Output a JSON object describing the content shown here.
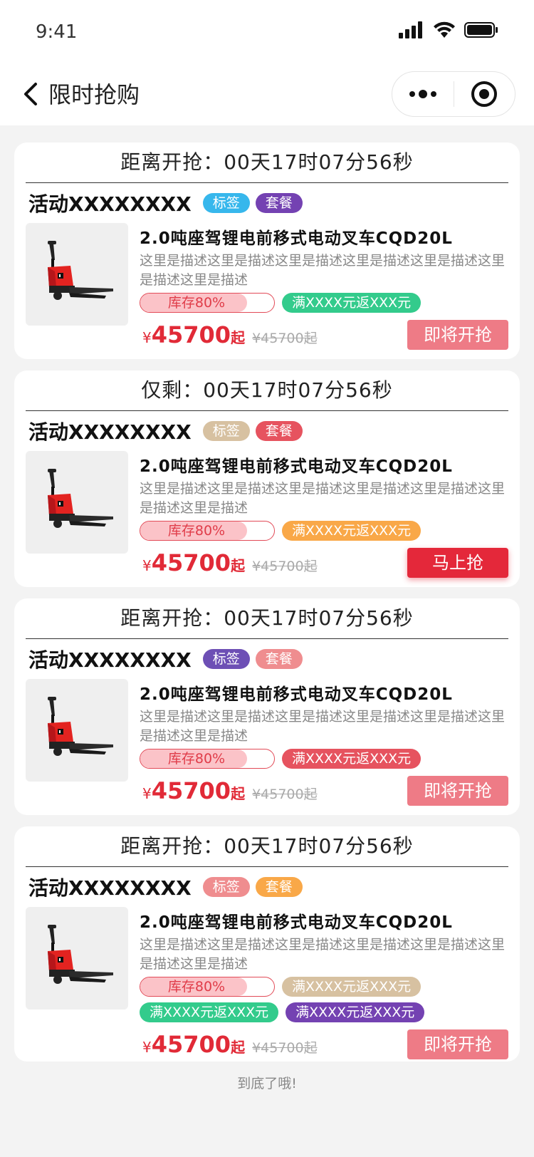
{
  "status": {
    "time": "9:41"
  },
  "nav": {
    "title": "限时抢购"
  },
  "colors": {
    "cyan": "#37b7ec",
    "purple": "#7442b2",
    "tan": "#d7c1a1",
    "red": "#e6535f",
    "orange": "#f9a848",
    "green": "#33cb8c",
    "violet": "#6d4fb5",
    "pink": "#ef8d8f"
  },
  "cards": [
    {
      "countdown": "距离开抢：00天17时07分56秒",
      "activity": "活动XXXXXXXX",
      "tags": [
        "标签",
        "套餐"
      ],
      "name": "2.0吨座驾锂电前移式电动叉车CQD20L",
      "desc": "这里是描述这里是描述这里是描述这里是描述这里是描述这里是描述这里是描述",
      "stock": "库存80%",
      "stock_pct": 80,
      "promos": [
        "满XXXX元返XXX元"
      ],
      "yen": "¥",
      "price": "45700",
      "qi": "起",
      "old_price": "¥45700起",
      "button": "即将开抢"
    },
    {
      "countdown": "仅剩：00天17时07分56秒",
      "activity": "活动XXXXXXXX",
      "tags": [
        "标签",
        "套餐"
      ],
      "name": "2.0吨座驾锂电前移式电动叉车CQD20L",
      "desc": "这里是描述这里是描述这里是描述这里是描述这里是描述这里是描述这里是描述",
      "stock": "库存80%",
      "stock_pct": 80,
      "promos": [
        "满XXXX元返XXX元"
      ],
      "yen": "¥",
      "price": "45700",
      "qi": "起",
      "old_price": "¥45700起",
      "button": "马上抢"
    },
    {
      "countdown": "距离开抢：00天17时07分56秒",
      "activity": "活动XXXXXXXX",
      "tags": [
        "标签",
        "套餐"
      ],
      "name": "2.0吨座驾锂电前移式电动叉车CQD20L",
      "desc": "这里是描述这里是描述这里是描述这里是描述这里是描述这里是描述这里是描述",
      "stock": "库存80%",
      "stock_pct": 80,
      "promos": [
        "满XXXX元返XXX元"
      ],
      "yen": "¥",
      "price": "45700",
      "qi": "起",
      "old_price": "¥45700起",
      "button": "即将开抢"
    },
    {
      "countdown": "距离开抢：00天17时07分56秒",
      "activity": "活动XXXXXXXX",
      "tags": [
        "标签",
        "套餐"
      ],
      "name": "2.0吨座驾锂电前移式电动叉车CQD20L",
      "desc": "这里是描述这里是描述这里是描述这里是描述这里是描述这里是描述这里是描述",
      "stock": "库存80%",
      "stock_pct": 80,
      "promos": [
        "满XXXX元返XXX元",
        "满XXXX元返XXX元",
        "满XXXX元返XXX元"
      ],
      "yen": "¥",
      "price": "45700",
      "qi": "起",
      "old_price": "¥45700起",
      "button": "即将开抢"
    }
  ],
  "footer": "到底了哦!"
}
